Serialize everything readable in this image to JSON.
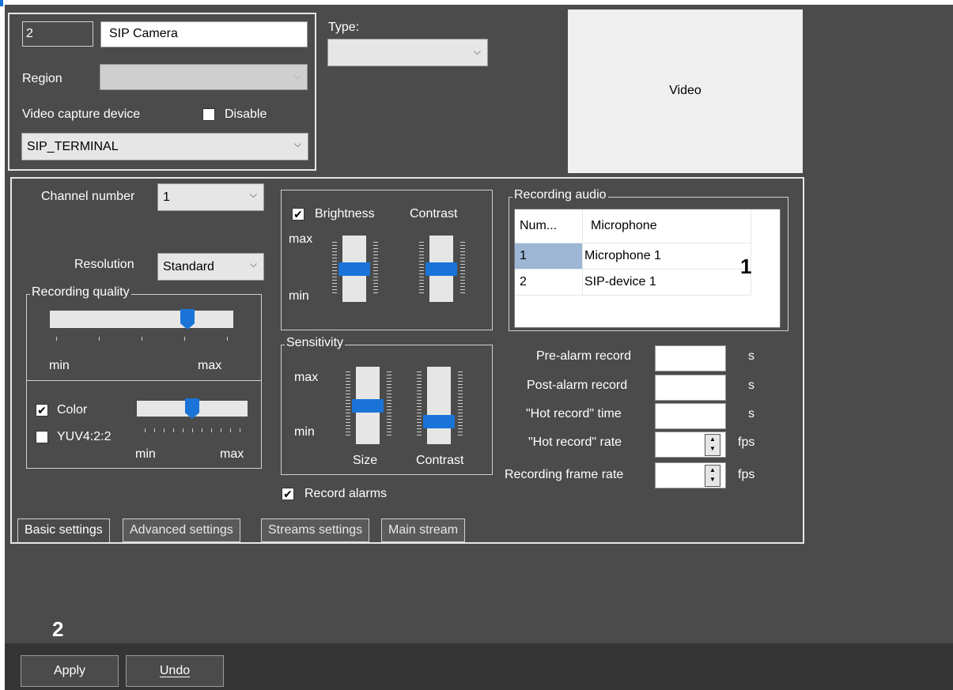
{
  "header": {
    "camera_id": "2",
    "camera_name": "SIP Camera",
    "type_label": "Type:",
    "type_value": ""
  },
  "region": {
    "label": "Region",
    "value": ""
  },
  "capture": {
    "label": "Video capture device",
    "disable_label": "Disable",
    "disable_checked": false,
    "device_value": "SIP_TERMINAL"
  },
  "video": {
    "label": "Video"
  },
  "basic": {
    "channel_label": "Channel number",
    "channel_value": "1",
    "resolution_label": "Resolution",
    "resolution_value": "Standard",
    "quality": {
      "title": "Recording quality",
      "min": "min",
      "max": "max",
      "level": 0.75
    },
    "color": {
      "color_label": "Color",
      "color_checked": true,
      "yuv_label": "YUV4:2:2",
      "yuv_checked": false,
      "min": "min",
      "max": "max",
      "level": 0.5
    },
    "image": {
      "brightness_label": "Brightness",
      "brightness_checked": true,
      "contrast_label": "Contrast",
      "max": "max",
      "min": "min",
      "brightness_level": 0.5,
      "contrast_level": 0.5
    },
    "sensitivity": {
      "title": "Sensitivity",
      "max": "max",
      "min": "min",
      "size_label": "Size",
      "contrast_label": "Contrast",
      "size_level": 0.5,
      "contrast_level": 0.3
    },
    "record_alarms": {
      "label": "Record alarms",
      "checked": true
    },
    "audio": {
      "title": "Recording audio",
      "columns": [
        "Num...",
        "Microphone"
      ],
      "rows": [
        {
          "num": "1",
          "mic": "Microphone 1",
          "selected": true
        },
        {
          "num": "2",
          "mic": "SIP-device 1",
          "selected": false
        }
      ]
    },
    "records": {
      "pre_alarm_label": "Pre-alarm record",
      "post_alarm_label": "Post-alarm record",
      "hot_time_label": "\"Hot record\" time",
      "hot_rate_label": "\"Hot record\" rate",
      "frame_rate_label": "Recording frame rate",
      "unit_s": "s",
      "unit_fps": "fps"
    }
  },
  "tabs": [
    "Basic settings",
    "Advanced settings",
    "Streams settings",
    "Main stream"
  ],
  "callouts": {
    "one": "1",
    "two": "2"
  },
  "buttons": {
    "apply": "Apply",
    "undo": "Undo"
  },
  "colors": {
    "panel_bg": "#4b4b4b",
    "bottom_bar": "#353535",
    "thumb_blue": "#1a73d6"
  }
}
